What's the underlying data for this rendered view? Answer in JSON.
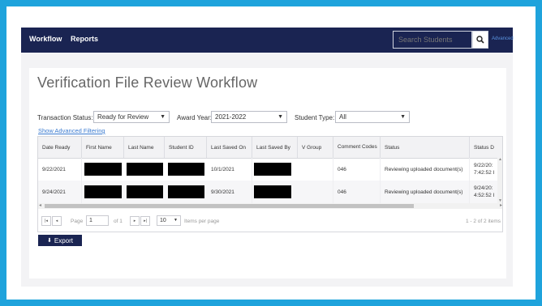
{
  "nav": {
    "items": [
      {
        "label": "Workflow"
      },
      {
        "label": "Reports"
      }
    ],
    "search_placeholder": "Search Students",
    "advanced_label": "Advanced"
  },
  "page": {
    "title": "Verification File Review Workflow"
  },
  "filters": {
    "transaction_status": {
      "label": "Transaction Status:",
      "value": "Ready for Review"
    },
    "award_year": {
      "label": "Award Year:",
      "value": "2021-2022"
    },
    "student_type": {
      "label": "Student Type:",
      "value": "All"
    },
    "show_advanced": "Show Advanced Filtering"
  },
  "table": {
    "columns": [
      "Date Ready",
      "First Name",
      "Last Name",
      "Student ID",
      "Last Saved On",
      "Last Saved By",
      "V Group",
      "Comment Codes",
      "Status",
      "Status D"
    ],
    "rows": [
      {
        "date_ready": "9/22/2021",
        "last_saved_on": "10/1/2021",
        "v_group": "",
        "comment_codes": "046",
        "status": "Reviewing uploaded document(s)",
        "status_date_1": "9/22/20:",
        "status_date_2": "7:42:52 I"
      },
      {
        "date_ready": "9/24/2021",
        "last_saved_on": "9/30/2021",
        "v_group": "",
        "comment_codes": "046",
        "status": "Reviewing uploaded document(s)",
        "status_date_1": "9/24/20:",
        "status_date_2": "4:52:52 I"
      }
    ]
  },
  "pager": {
    "page_label": "Page",
    "page_value": "1",
    "of_label": "of 1",
    "per_page": "10",
    "per_page_label": "Items per page",
    "summary": "1 - 2 of 2 items"
  },
  "export_label": "Export",
  "colors": {
    "navbar": "#1a2452",
    "frame": "#1fa3dc",
    "link": "#3b7bd0"
  }
}
